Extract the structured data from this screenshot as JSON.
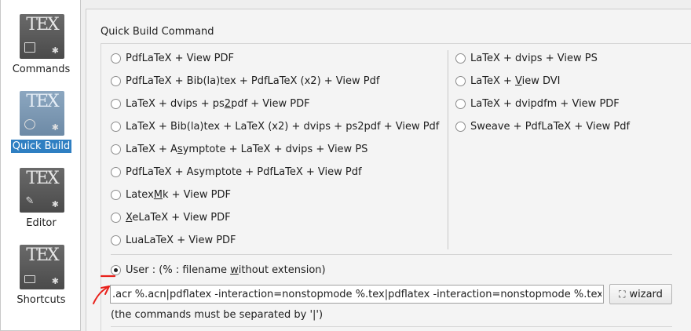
{
  "sidebar": {
    "items": [
      {
        "label": "Commands",
        "selected": false,
        "icon": "tex-commands-icon"
      },
      {
        "label": "Quick Build",
        "selected": true,
        "icon": "tex-quickbuild-icon"
      },
      {
        "label": "Editor",
        "selected": false,
        "icon": "tex-editor-icon"
      },
      {
        "label": "Shortcuts",
        "selected": false,
        "icon": "tex-shortcuts-icon"
      }
    ],
    "logo_text": "TEX",
    "selected_color": "#2f7fc2"
  },
  "quick_build": {
    "title": "Quick Build Command",
    "left_options": [
      {
        "pre": "PdfLaTeX + View PDF",
        "ul": "",
        "post": ""
      },
      {
        "pre": "PdfLaTeX + Bib(la)tex + PdfLaTeX (x2) + View Pdf",
        "ul": "",
        "post": ""
      },
      {
        "pre": "LaTeX + dvips + ps",
        "ul": "2",
        "post": "pdf + View PDF"
      },
      {
        "pre": "LaTeX + Bib(la)tex + LaTeX (x2) + dvips + ps2pdf + View Pdf",
        "ul": "",
        "post": ""
      },
      {
        "pre": "LaTeX + A",
        "ul": "s",
        "post": "ymptote + LaTeX + dvips + View PS"
      },
      {
        "pre": "PdfLaTeX + Asymptote + PdfLaTeX + View Pdf",
        "ul": "",
        "post": ""
      },
      {
        "pre": "Latex",
        "ul": "M",
        "post": "k + View PDF"
      },
      {
        "pre": "",
        "ul": "X",
        "post": "eLaTeX + View PDF"
      },
      {
        "pre": "LuaLaTeX + View PDF",
        "ul": "",
        "post": ""
      }
    ],
    "right_options": [
      {
        "pre": "LaTeX + dvips + View PS",
        "ul": "",
        "post": ""
      },
      {
        "pre": "LaTeX + ",
        "ul": "V",
        "post": "iew DVI"
      },
      {
        "pre": "LaTeX + dvipdfm + View PDF",
        "ul": "",
        "post": ""
      },
      {
        "pre": "Sweave + PdfLaTeX + View Pdf",
        "ul": "",
        "post": ""
      }
    ],
    "user_option": {
      "pre": "User : (% : filename ",
      "ul": "w",
      "post": "ithout extension)",
      "checked": true
    },
    "command_value": ".acr %.acn|pdflatex -interaction=nonstopmode %.tex|pdflatex -interaction=nonstopmode %.tex",
    "wizard_label": "wizard",
    "note": "(the commands must be separated by '|')"
  },
  "colors": {
    "annotation": "#e8211b"
  }
}
